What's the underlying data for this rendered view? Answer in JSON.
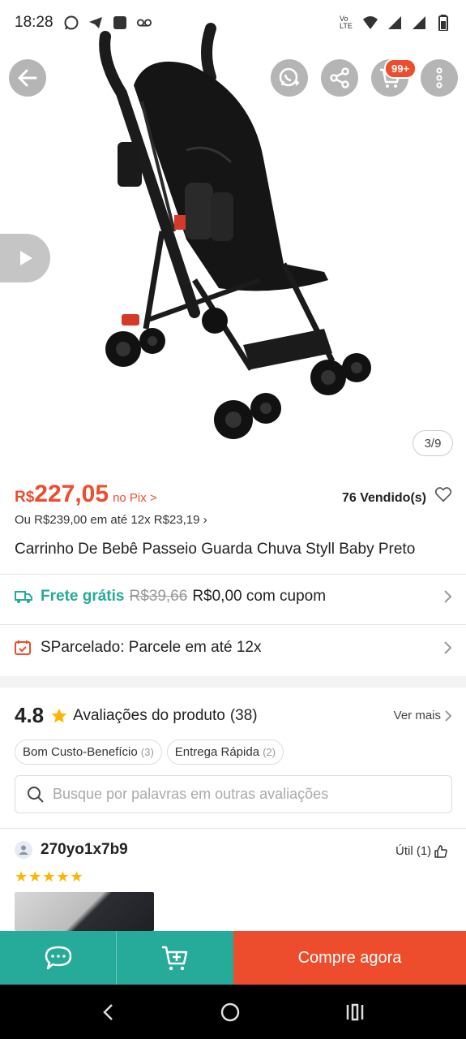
{
  "status_bar": {
    "time": "18:28",
    "left_icons": [
      "whatsapp-icon",
      "telegram-icon",
      "app-icon",
      "voicemail-icon"
    ],
    "right_icons": [
      "volte-icon",
      "wifi-icon",
      "signal-icon",
      "signal-icon",
      "battery-icon"
    ],
    "volte_text": "Vo LTE"
  },
  "header": {
    "cart_badge": "99+"
  },
  "gallery": {
    "counter": "3/9"
  },
  "price": {
    "currency": "R$",
    "amount": "227,05",
    "pix_label": "no Pix >",
    "sold": "76 Vendido(s)",
    "installments": "Ou R$239,00 em até 12x R$23,19 ›"
  },
  "product": {
    "title": "Carrinho De Bebê Passeio Guarda Chuva Styll Baby Preto"
  },
  "shipping": {
    "label": "Frete grátis",
    "old_price": "R$39,66",
    "new_text": "R$0,00 com cupom"
  },
  "installment_row": {
    "text": "SParcelado: Parcele em até 12x"
  },
  "reviews": {
    "rating": "4.8",
    "title": "Avaliações do produto",
    "count": "(38)",
    "see_more": "Ver mais",
    "chips": [
      {
        "label": "Bom Custo-Benefício",
        "count": "(3)"
      },
      {
        "label": "Entrega Rápida",
        "count": "(2)"
      }
    ],
    "search_placeholder": "Busque por palavras em outras avaliações",
    "first_review": {
      "user": "270yo1x7b9",
      "useful": "Útil (1)",
      "stars": "★★★★★"
    }
  },
  "bottom_bar": {
    "buy_label": "Compre agora"
  },
  "colors": {
    "brand": "#ee4d2d",
    "teal": "#26aa99",
    "star": "#ffb400"
  }
}
